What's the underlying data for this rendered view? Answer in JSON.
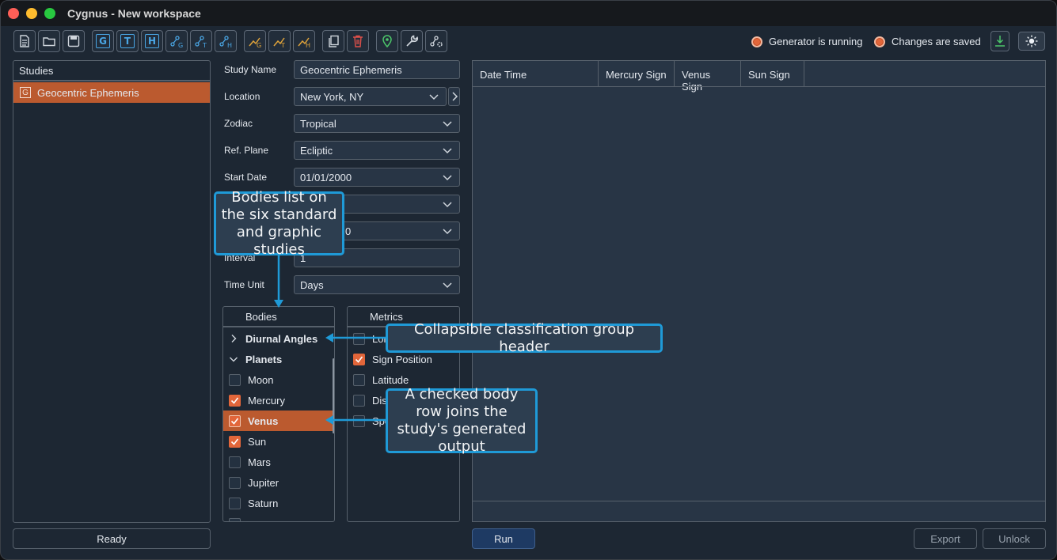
{
  "window": {
    "title": "Cygnus - New workspace"
  },
  "toolbar": {
    "letters": [
      "G",
      "T",
      "H"
    ],
    "status_generator": "Generator is running",
    "status_saved": "Changes are saved"
  },
  "studies": {
    "header": "Studies",
    "items": [
      {
        "icon": "G",
        "label": "Geocentric Ephemeris"
      }
    ],
    "ready_label": "Ready"
  },
  "form": {
    "study_name_label": "Study Name",
    "study_name_value": "Geocentric Ephemeris",
    "location_label": "Location",
    "location_value": "New York, NY",
    "zodiac_label": "Zodiac",
    "zodiac_value": "Tropical",
    "ref_plane_label": "Ref. Plane",
    "ref_plane_value": "Ecliptic",
    "start_date_label": "Start Date",
    "start_date_value": "01/01/2000",
    "row6_value_partial": "0",
    "interval_label": "Interval",
    "interval_value": "1",
    "time_unit_label": "Time Unit",
    "time_unit_value": "Days"
  },
  "bodies": {
    "header": "Bodies",
    "groups": [
      {
        "label": "Diurnal Angles",
        "expanded": false
      },
      {
        "label": "Planets",
        "expanded": true
      }
    ],
    "items": [
      {
        "label": "Moon",
        "checked": false
      },
      {
        "label": "Mercury",
        "checked": true
      },
      {
        "label": "Venus",
        "checked": true
      },
      {
        "label": "Sun",
        "checked": true
      },
      {
        "label": "Mars",
        "checked": false
      },
      {
        "label": "Jupiter",
        "checked": false
      },
      {
        "label": "Saturn",
        "checked": false
      }
    ]
  },
  "metrics": {
    "header": "Metrics",
    "items": [
      {
        "label": "Lor",
        "checked": false
      },
      {
        "label": "Sign Position",
        "checked": true
      },
      {
        "label": "Latitude",
        "checked": false
      },
      {
        "label": "Dis",
        "checked": false
      },
      {
        "label": "Spe",
        "checked": false
      }
    ]
  },
  "table": {
    "columns": [
      "Date Time",
      "Mercury Sign",
      "Venus Sign",
      "Sun Sign"
    ]
  },
  "actions": {
    "run": "Run",
    "export": "Export",
    "unlock": "Unlock"
  },
  "callouts": {
    "bodies_list": "Bodies list on the six standard and graphic studies",
    "group_header": "Collapsible classification group header",
    "checked_row": "A checked body row joins the study's generated output"
  },
  "colors": {
    "accent": "#e2663a",
    "selection": "#bb5a2f",
    "callout_border": "#1f9ad7",
    "run_button": "#1e3a63"
  }
}
